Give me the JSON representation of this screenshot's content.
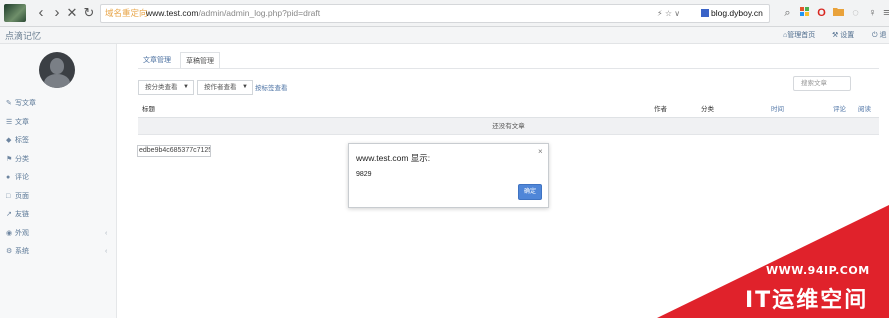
{
  "browser": {
    "secure_label": "域名重定向",
    "url_host": "www.test.com",
    "url_path": "/admin/admin_log.php?pid=draft",
    "url_right": "⚡ ☆  ∨",
    "search_engine": "blog.dyboy.cn"
  },
  "site": {
    "name": "点滴记忆",
    "links": {
      "home": "管理首页",
      "settings": "设置",
      "logout": "退"
    }
  },
  "sidebar": {
    "items": [
      {
        "icon": "✎",
        "label": "写文章",
        "caret": ""
      },
      {
        "icon": "☰",
        "label": "文章",
        "caret": ""
      },
      {
        "icon": "◆",
        "label": "标签",
        "caret": ""
      },
      {
        "icon": "⚑",
        "label": "分类",
        "caret": ""
      },
      {
        "icon": "●",
        "label": "评论",
        "caret": ""
      },
      {
        "icon": "□",
        "label": "页面",
        "caret": ""
      },
      {
        "icon": "↗",
        "label": "友链",
        "caret": ""
      },
      {
        "icon": "◉",
        "label": "外观",
        "caret": "‹"
      },
      {
        "icon": "⚙",
        "label": "系统",
        "caret": "‹"
      }
    ]
  },
  "tabs": [
    "文章管理",
    "草稿管理"
  ],
  "filters": {
    "by_category": "按分类查看",
    "by_author": "按作者查看",
    "by_tag": "按标签查看",
    "search_placeholder": "搜索文章"
  },
  "table": {
    "columns": {
      "title": "标题",
      "author": "作者",
      "category": "分类",
      "time": "时间",
      "comments": "评论",
      "reads": "阅读"
    },
    "empty_text": "还没有文章"
  },
  "hash_value": "edbe9b4c685377c7125",
  "dialog": {
    "title": "www.test.com 显示:",
    "close": "×",
    "message": "9829",
    "ok_label": "确定"
  },
  "watermark": {
    "url": "WWW.94IP.COM",
    "brand": "IT运维空间"
  },
  "colors": {
    "link": "#4e74a6",
    "ok_button": "#4f86d8",
    "watermark_red": "#e0222b"
  }
}
